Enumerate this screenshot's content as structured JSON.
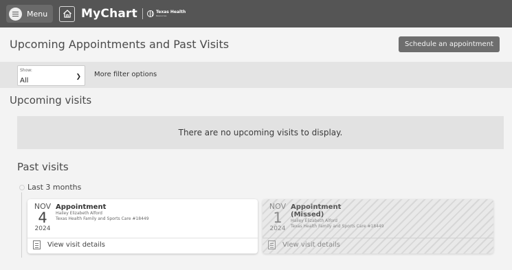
{
  "header": {
    "menu_label": "Menu",
    "brand": "MyChart",
    "partner_name": "Texas Health",
    "partner_sub": "Resources"
  },
  "page": {
    "title": "Upcoming Appointments and Past Visits",
    "schedule_button": "Schedule an appointment"
  },
  "filter": {
    "show_label": "Show:",
    "show_value": "All",
    "more_options": "More filter options"
  },
  "upcoming": {
    "heading": "Upcoming visits",
    "empty_message": "There are no upcoming visits to display."
  },
  "past": {
    "heading": "Past visits",
    "range_label": "Last 3 months",
    "visits": [
      {
        "month": "NOV",
        "day": "4",
        "year": "2024",
        "title": "Appointment",
        "provider": "Hailey Elizabeth Alford",
        "location": "Texas Health Family and Sports Care #18449",
        "link": "View visit details"
      },
      {
        "month": "NOV",
        "day": "1",
        "year": "2024",
        "title": "Appointment",
        "title_line2": "(Missed)",
        "provider": "Hailey Elizabeth Alford",
        "location": "Texas Health Family and Sports Care #18449",
        "link": "View visit details"
      }
    ]
  },
  "colors": {
    "header_bg": "#555555",
    "accent_button": "#6e6e6e",
    "page_bg": "#f3f3f3"
  },
  "icons": {
    "menu": "menu-icon",
    "home": "home-icon",
    "partner_logo": "globe-icon",
    "visit_details": "document-icon",
    "dropdown": "chevron-down-icon"
  }
}
